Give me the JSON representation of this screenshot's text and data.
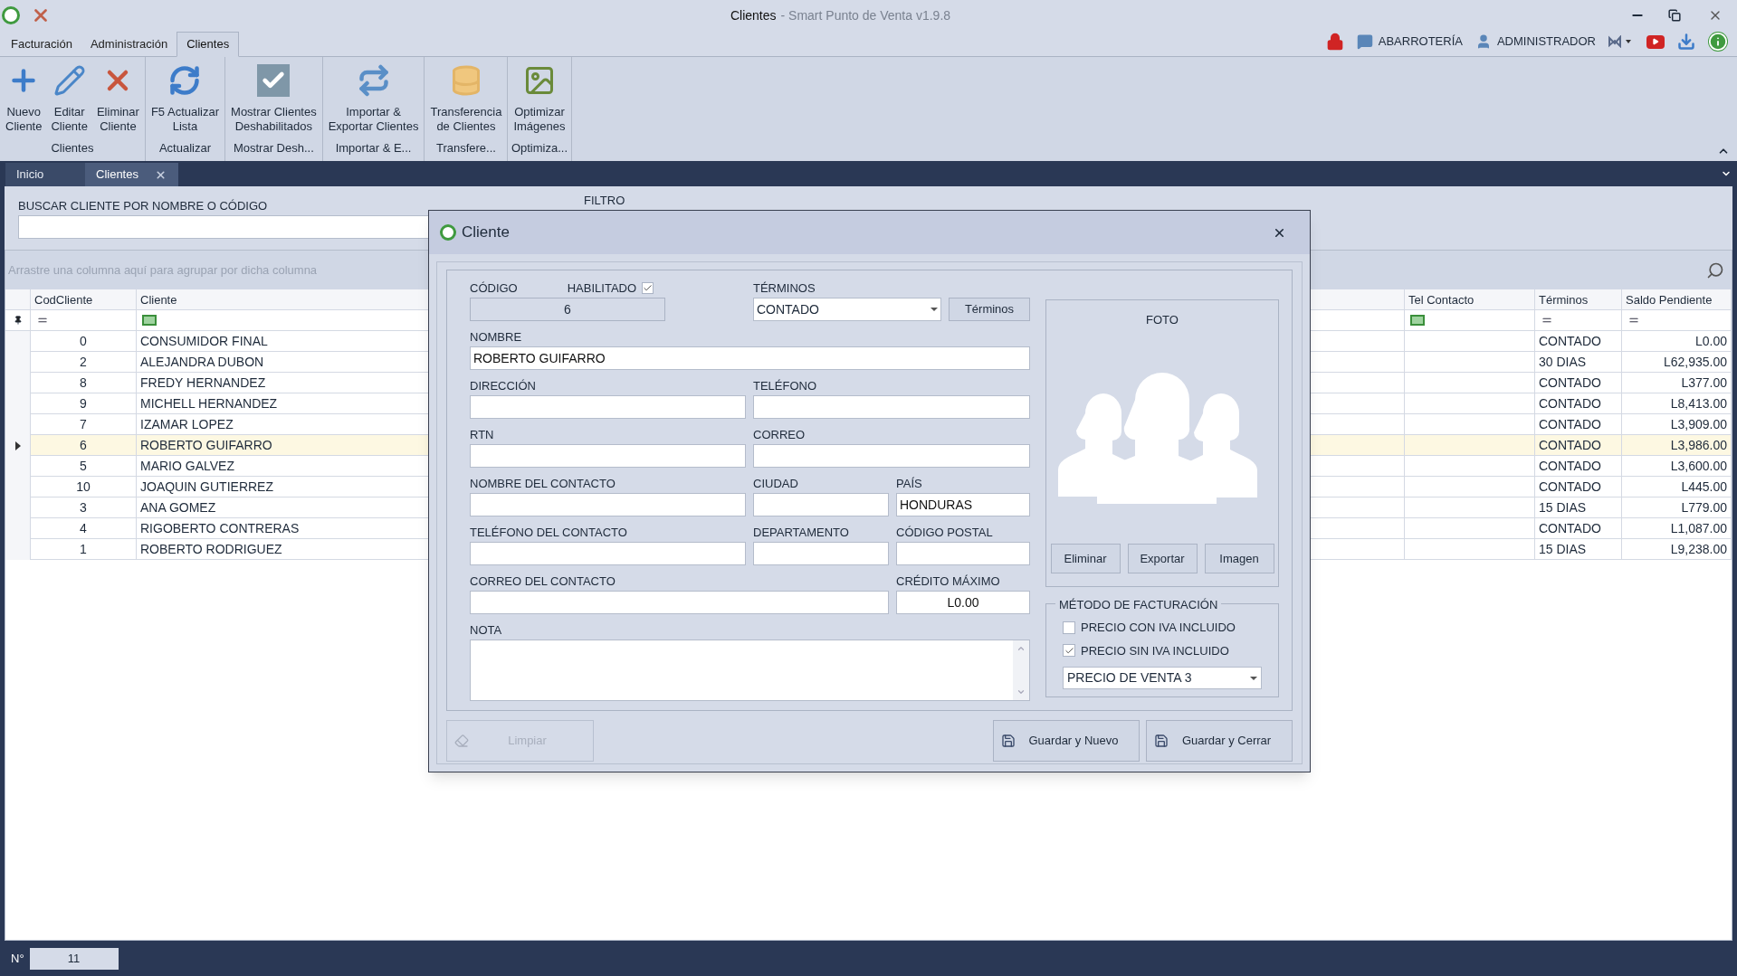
{
  "window": {
    "title": "Clientes",
    "subtitle": "- Smart Punto de Venta v1.9.8"
  },
  "menu_tabs": [
    {
      "label": "Facturación",
      "selected": false
    },
    {
      "label": "Administración",
      "selected": false
    },
    {
      "label": "Clientes",
      "selected": true
    }
  ],
  "header": {
    "store": "ABARROTERÍA",
    "user": "ADMINISTRADOR"
  },
  "ribbon": [
    {
      "label": "Clientes",
      "buttons": [
        {
          "label": "Nuevo\nCliente",
          "kind": "plus"
        },
        {
          "label": "Editar\nCliente",
          "kind": "pencil"
        },
        {
          "label": "Eliminar\nCliente",
          "kind": "delete"
        }
      ]
    },
    {
      "label": "Actualizar",
      "buttons": [
        {
          "label": "F5 Actualizar\nLista",
          "kind": "refresh"
        }
      ]
    },
    {
      "label": "Mostrar Desh...",
      "buttons": [
        {
          "label": "Mostrar Clientes\nDeshabilitados",
          "kind": "check"
        }
      ]
    },
    {
      "label": "Importar & E...",
      "buttons": [
        {
          "label": "Importar &\nExportar Clientes",
          "kind": "sync"
        }
      ]
    },
    {
      "label": "Transfere...",
      "buttons": [
        {
          "label": "Transferencia\nde Clientes",
          "kind": "database"
        }
      ]
    },
    {
      "label": "Optimiza...",
      "buttons": [
        {
          "label": "Optimizar\nImágenes",
          "kind": "image"
        }
      ]
    }
  ],
  "doc_tabs": [
    {
      "label": "Inicio",
      "selected": false,
      "closable": false
    },
    {
      "label": "Clientes",
      "selected": true,
      "closable": true
    }
  ],
  "search": {
    "label": "BUSCAR CLIENTE POR NOMBRE O CÓDIGO",
    "filter_label": "FILTRO"
  },
  "grid": {
    "group_hint": "Arrastre una columna aquí para agrupar por dicha columna",
    "columns": [
      {
        "label": "CodCliente",
        "kind": "equals"
      },
      {
        "label": "Cliente",
        "kind": "text"
      },
      {
        "label": "Tel Contacto",
        "kind": "text"
      },
      {
        "label": "Términos",
        "kind": "equals"
      },
      {
        "label": "Saldo Pendiente",
        "kind": "equals"
      }
    ],
    "rows": [
      {
        "cod": "0",
        "cliente": "CONSUMIDOR FINAL",
        "terminos": "CONTADO",
        "saldo": "L0.00",
        "selected": false
      },
      {
        "cod": "2",
        "cliente": "ALEJANDRA DUBON",
        "terminos": "30 DIAS",
        "saldo": "L62,935.00",
        "selected": false
      },
      {
        "cod": "8",
        "cliente": "FREDY HERNANDEZ",
        "terminos": "CONTADO",
        "saldo": "L377.00",
        "selected": false
      },
      {
        "cod": "9",
        "cliente": "MICHELL HERNANDEZ",
        "terminos": "CONTADO",
        "saldo": "L8,413.00",
        "selected": false
      },
      {
        "cod": "7",
        "cliente": "IZAMAR LOPEZ",
        "terminos": "CONTADO",
        "saldo": "L3,909.00",
        "selected": false
      },
      {
        "cod": "6",
        "cliente": "ROBERTO GUIFARRO",
        "terminos": "CONTADO",
        "saldo": "L3,986.00",
        "selected": true
      },
      {
        "cod": "5",
        "cliente": "MARIO GALVEZ",
        "terminos": "CONTADO",
        "saldo": "L3,600.00",
        "selected": false
      },
      {
        "cod": "10",
        "cliente": "JOAQUIN GUTIERREZ",
        "terminos": "CONTADO",
        "saldo": "L445.00",
        "selected": false
      },
      {
        "cod": "3",
        "cliente": "ANA GOMEZ",
        "terminos": "15 DIAS",
        "saldo": "L779.00",
        "selected": false
      },
      {
        "cod": "4",
        "cliente": "RIGOBERTO CONTRERAS",
        "terminos": "CONTADO",
        "saldo": "L1,087.00",
        "selected": false
      },
      {
        "cod": "1",
        "cliente": "ROBERTO RODRIGUEZ",
        "terminos": "15 DIAS",
        "saldo": "L9,238.00",
        "selected": false
      }
    ]
  },
  "status_bar": {
    "label": "N°",
    "count": "11"
  },
  "dialog": {
    "title": "Cliente",
    "codigo": {
      "label": "CÓDIGO",
      "value": "6"
    },
    "habilitado": {
      "label": "HABILITADO",
      "checked": true
    },
    "terminos": {
      "label": "TÉRMINOS",
      "value": "CONTADO",
      "button": "Términos"
    },
    "nombre": {
      "label": "NOMBRE",
      "value": "ROBERTO GUIFARRO"
    },
    "direccion": {
      "label": "DIRECCIÓN"
    },
    "telefono": {
      "label": "TELÉFONO"
    },
    "rtn": {
      "label": "RTN"
    },
    "correo": {
      "label": "CORREO"
    },
    "nombre_contacto": {
      "label": "NOMBRE DEL CONTACTO"
    },
    "ciudad": {
      "label": "CIUDAD"
    },
    "pais": {
      "label": "PAÍS",
      "value": "HONDURAS"
    },
    "telefono_contacto": {
      "label": "TELÉFONO DEL CONTACTO"
    },
    "departamento": {
      "label": "DEPARTAMENTO"
    },
    "codigo_postal": {
      "label": "CÓDIGO POSTAL"
    },
    "correo_contacto": {
      "label": "CORREO DEL CONTACTO"
    },
    "credito_maximo": {
      "label": "CRÉDITO MÁXIMO",
      "value": "L0.00"
    },
    "nota": {
      "label": "NOTA"
    },
    "photo": {
      "label": "FOTO",
      "buttons": [
        "Eliminar",
        "Exportar",
        "Imagen"
      ]
    },
    "billing": {
      "label": "MÉTODO DE FACTURACIÓN",
      "options": [
        {
          "label": "PRECIO CON IVA INCLUIDO",
          "checked": false
        },
        {
          "label": "PRECIO SIN IVA INCLUIDO",
          "checked": true
        }
      ],
      "price_list": "PRECIO DE VENTA 3"
    },
    "limpiar": {
      "label": "Limpiar",
      "disabled": true
    },
    "actions": [
      "Guardar y Nuevo",
      "Guardar y Cerrar"
    ]
  }
}
